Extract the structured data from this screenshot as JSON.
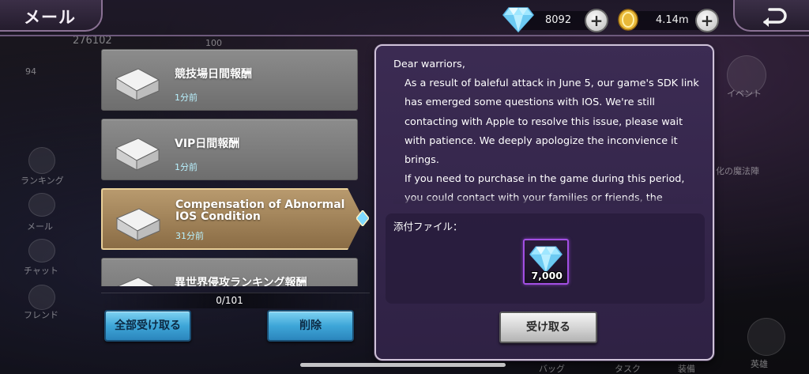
{
  "header": {
    "title": "メール",
    "gems": "8092",
    "gold": "4.14m"
  },
  "background": {
    "power": "276102",
    "level": "94",
    "badge_count": "100",
    "side_labels": [
      "ランキング",
      "メール",
      "チャット",
      "フレンド"
    ],
    "right_label": "イベント",
    "banner": "化の魔法陣",
    "bottom_labels": [
      "バッグ",
      "タスク",
      "装備",
      "英雄"
    ]
  },
  "mail_list": {
    "items": [
      {
        "title": "競技場日間報酬",
        "time": "1分前"
      },
      {
        "title": "VIP日間報酬",
        "time": "1分前"
      },
      {
        "title": "Compensation of Abnormal IOS Condition",
        "time": "31分前"
      },
      {
        "title": "異世界侵攻ランキング報酬",
        "time": ""
      }
    ],
    "count": "0/101",
    "claim_all_label": "全部受け取る",
    "delete_label": "削除"
  },
  "detail": {
    "greeting": "Dear warriors,",
    "paragraph1": "As a result of baleful attack in June 5, our game's SDK link has emerged some questions with IOS. We're still contacting with Apple to resolve this issue, please wait with patience. We deeply apologize the inconvience it brings.",
    "paragraph2": "If you need to purchase in the game during this period, you could contact with your families or friends, the Android users, to help you. But we suggest that you'd better not",
    "attachment_label": "添付ファイル：",
    "attachment_qty": "7,000",
    "receive_label": "受け取る"
  }
}
